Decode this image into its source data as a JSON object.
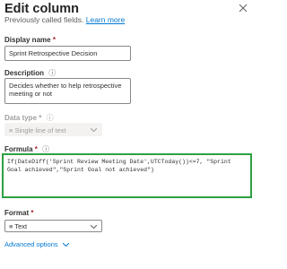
{
  "panel": {
    "title": "Edit column",
    "subtitle": "Previously called fields.",
    "learn_more": "Learn more"
  },
  "display_name": {
    "label": "Display name",
    "required_mark": "*",
    "value": "Sprint Retrospective Decision"
  },
  "description": {
    "label": "Description",
    "value": "Decides whether to help retrospective meeting or not"
  },
  "data_type": {
    "label": "Data type",
    "required_mark": "*",
    "value": "Single line of text"
  },
  "formula": {
    "label": "Formula",
    "required_mark": "*",
    "value": "If(DateDiff('Sprint Review Meeting Date',UTCToday())<=7, \"Sprint Goal achieved\",\"Sprint Goal not achieved\")"
  },
  "format": {
    "label": "Format",
    "required_mark": "*",
    "value": "Text"
  },
  "advanced_options": "Advanced options",
  "colors": {
    "accent": "#0078d4",
    "highlight": "#2ea043",
    "required": "#a4262c"
  },
  "icons": [
    "close-icon",
    "info-icon",
    "chevron-down-icon",
    "text-icon"
  ]
}
